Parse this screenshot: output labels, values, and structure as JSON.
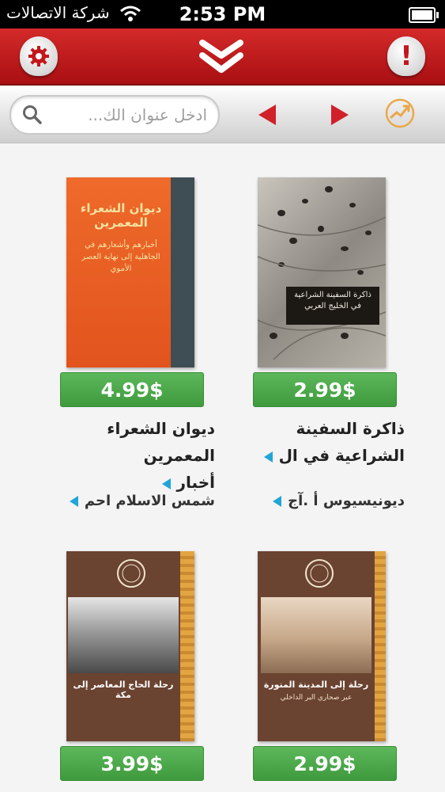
{
  "status_bar": {
    "carrier": "شركة الاتصالات",
    "time": "2:53 PM"
  },
  "header": {
    "settings_icon": "gear-icon",
    "collapse_icon": "double-chevron-down-icon",
    "alert_icon": "exclamation-icon",
    "alert_glyph": "!"
  },
  "search": {
    "placeholder": "ادخل عنوان الك..."
  },
  "books": [
    {
      "cover_title": "ذاكرة السفينة الشراعية في الخليج العربي",
      "price": "2.99$",
      "title_line1": "ذاكرة السفينة",
      "title_line2": "الشراعية في ال",
      "author": "ديونيسيوس أ .آج"
    },
    {
      "cover_title": "ديوان الشعراء المعمرين",
      "cover_subtitle": "أخبارهم وأشعارهم في الجاهلية إلى نهاية العصر الأموي",
      "price": "4.99$",
      "title_line1": "ديوان الشعراء المعمرين",
      "title_line2": "أخبار",
      "author": "شمس الاسلام احم"
    },
    {
      "cover_title": "رحلة إلى المدينة المنورة",
      "cover_subtitle": "عبر صحاري البر الداخلي",
      "price": "2.99$"
    },
    {
      "cover_title": "رحلة الحاج المعاصر إلى مكة",
      "price": "3.99$"
    }
  ],
  "colors": {
    "header_red": "#c4161c",
    "price_green": "#4caf50",
    "accent_blue": "#21a5d8",
    "nav_arrow_red": "#d0202a"
  }
}
